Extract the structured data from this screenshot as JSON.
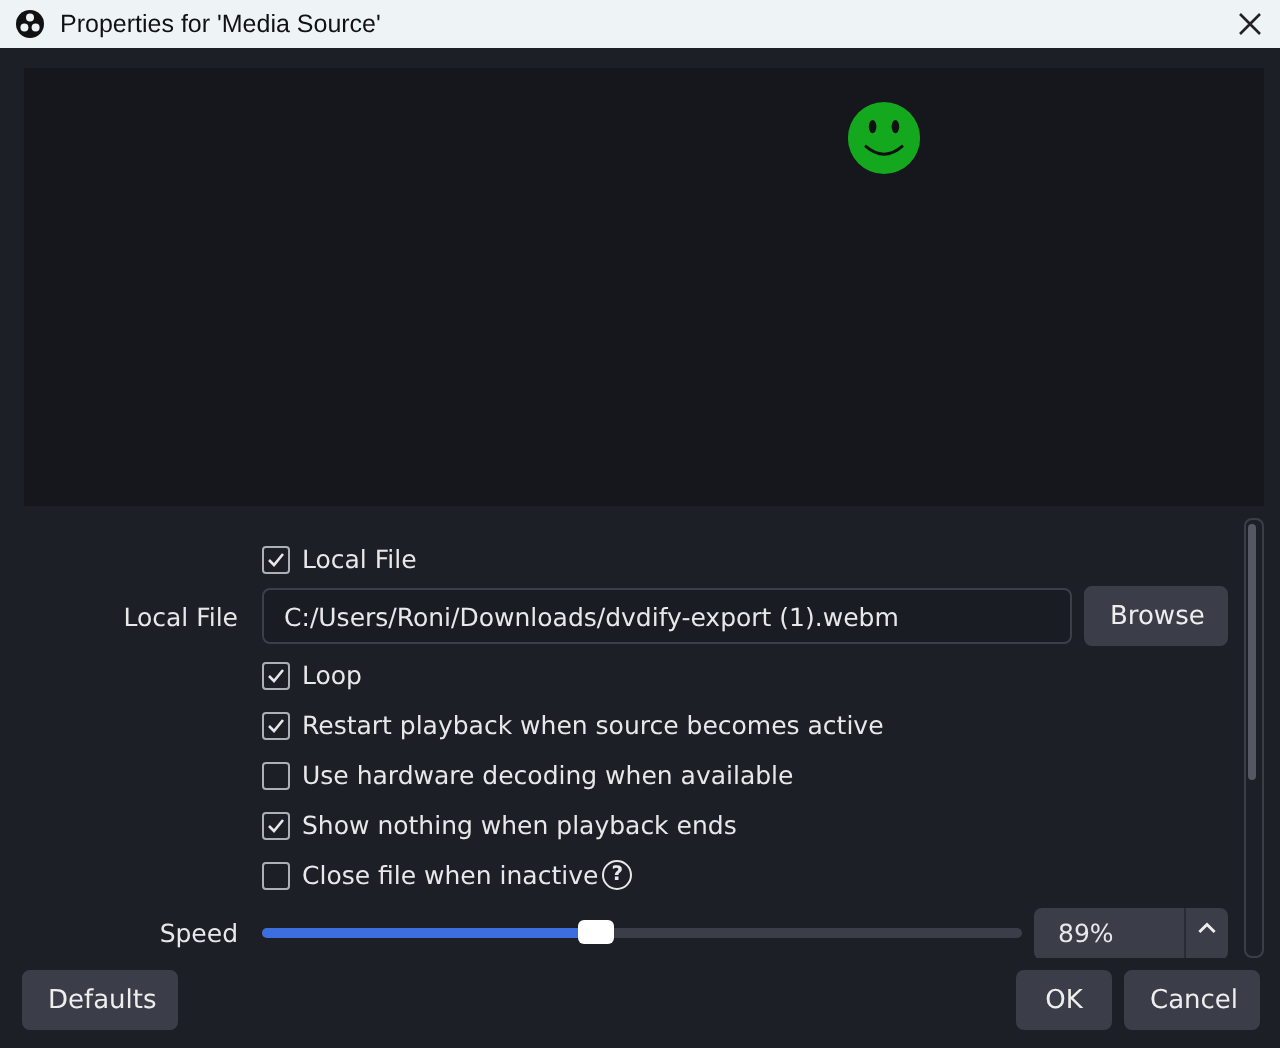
{
  "window": {
    "title": "Properties for 'Media Source'"
  },
  "properties": [
    {
      "kind": "checkbox",
      "label": "Local File",
      "checked": true
    },
    {
      "kind": "file",
      "label": "Local File",
      "value": "C:/Users/Roni/Downloads/dvdify-export (1).webm",
      "button": "Browse"
    },
    {
      "kind": "checkbox",
      "label": "Loop",
      "checked": true
    },
    {
      "kind": "checkbox",
      "label": "Restart playback when source becomes active",
      "checked": true
    },
    {
      "kind": "checkbox",
      "label": "Use hardware decoding when available",
      "checked": false
    },
    {
      "kind": "checkbox",
      "label": "Show nothing when playback ends",
      "checked": true
    },
    {
      "kind": "checkbox",
      "label": "Close file when inactive",
      "checked": false,
      "help": "?"
    },
    {
      "kind": "slider",
      "label": "Speed",
      "level": 0.44,
      "value": "89%"
    }
  ],
  "buttons": {
    "defaults": "Defaults",
    "ok": "OK",
    "cancel": "Cancel"
  }
}
